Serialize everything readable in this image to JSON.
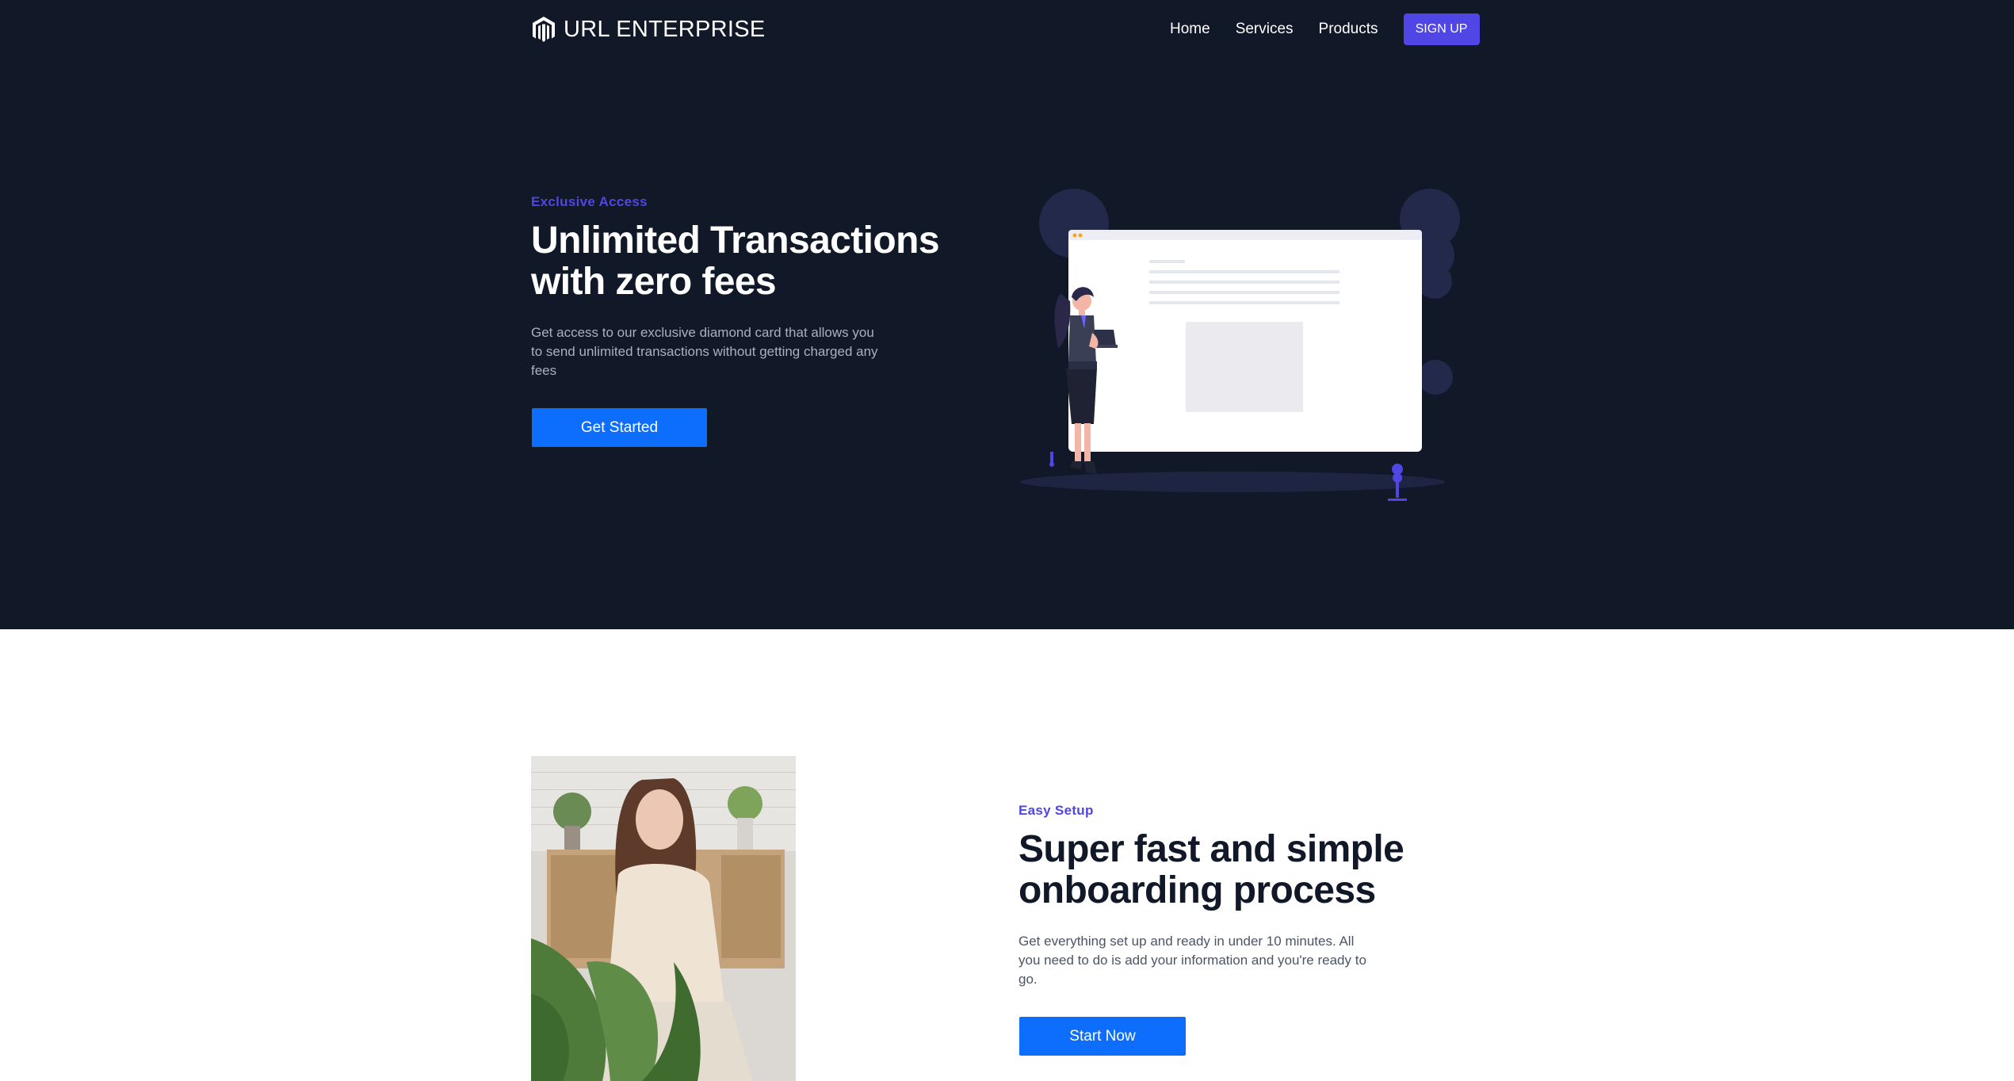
{
  "nav": {
    "brand": "URL ENTERPRISE",
    "links": [
      "Home",
      "Services",
      "Products"
    ],
    "signup_label": "SIGN UP"
  },
  "hero": {
    "eyebrow": "Exclusive Access",
    "title_line1": "Unlimited Transactions",
    "title_line2": "with zero fees",
    "description": "Get access to our exclusive diamond card that allows you to send unlimited transactions without getting charged any fees",
    "cta_label": "Get Started"
  },
  "onboarding": {
    "eyebrow": "Easy Setup",
    "title_line1": "Super fast and simple",
    "title_line2": "onboarding process",
    "description": "Get everything set up and ready in under 10 minutes. All you need to do is add your information and you're ready to go.",
    "cta_label": "Start Now"
  },
  "colors": {
    "hero_background": "#111827",
    "accent": "#4f46e5",
    "button_blue": "#0d6efd"
  },
  "icons": {
    "logo": "magento-logo-icon"
  }
}
